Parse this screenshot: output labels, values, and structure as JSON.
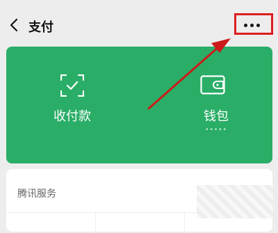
{
  "header": {
    "title": "支付",
    "back_icon": "chevron-left-icon",
    "more_icon": "more-dots-icon"
  },
  "main_card": {
    "color": "#2aae67",
    "items": [
      {
        "label": "收付款",
        "icon": "scan-qr-icon"
      },
      {
        "label": "钱包",
        "icon": "wallet-icon",
        "masked_balance": "•••••"
      }
    ]
  },
  "services": {
    "title": "腾讯服务"
  },
  "annotation": {
    "highlight_color": "#dd1d1d",
    "arrow_color": "#cc1b1b"
  }
}
